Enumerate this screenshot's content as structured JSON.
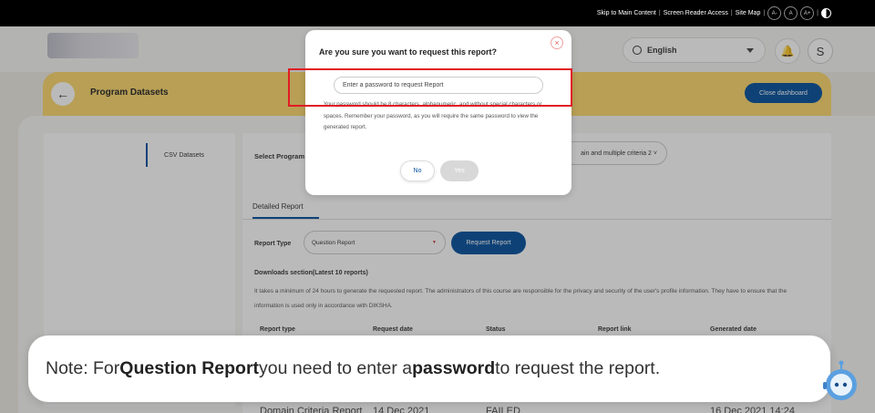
{
  "topbar": {
    "skip": "Skip to Main Content",
    "screen_reader": "Screen Reader Access",
    "site_map": "Site Map",
    "font_decrease": "A-",
    "font_normal": "A",
    "font_increase": "A+"
  },
  "header": {
    "language": "English",
    "avatar_initial": "S"
  },
  "banner": {
    "title": "Program Datasets",
    "close_dashboard": "Close dashboard"
  },
  "sidebar": {
    "csv_datasets": "CSV Datasets"
  },
  "main": {
    "select_program_label": "Select Program",
    "criteria_value": "ain and multiple criteria 2",
    "tab_detailed_report": "Detailed Report",
    "report_type_label": "Report Type",
    "report_type_value": "Question Report",
    "request_report": "Request Report",
    "downloads_title": "Downloads section(Latest 10 reports)",
    "downloads_desc": "It takes a minimum of 24 hours to generate the requested report. The administrators of this course are responsible for the privacy and security of the user's profile information. They have to ensure that the information is used only in accordance with DIKSHA.",
    "table_headers": [
      "Report type",
      "Request date",
      "Status",
      "Report link",
      "Generated date"
    ],
    "row": [
      "Domain Criteria Report",
      "14 Dec 2021",
      "FAILED",
      "",
      "16 Dec 2021 14:24"
    ]
  },
  "modal": {
    "title": "Are you sure you want to request this report?",
    "password_placeholder": "Enter a password to request Report",
    "hint": "Your password should be 8 characters, alphanumeric, and without special characters or spaces. Remember your password, as you will require the same password to view the generated report.",
    "no": "No",
    "yes": "Yes"
  },
  "note": {
    "prefix": "Note: For ",
    "bold1": "Question Report",
    "middle": " you need to enter a ",
    "bold2": "password",
    "suffix": " to request the report."
  },
  "colors": {
    "primary": "#024f9d",
    "banner": "#fdd86b",
    "highlight": "#e01b24"
  }
}
